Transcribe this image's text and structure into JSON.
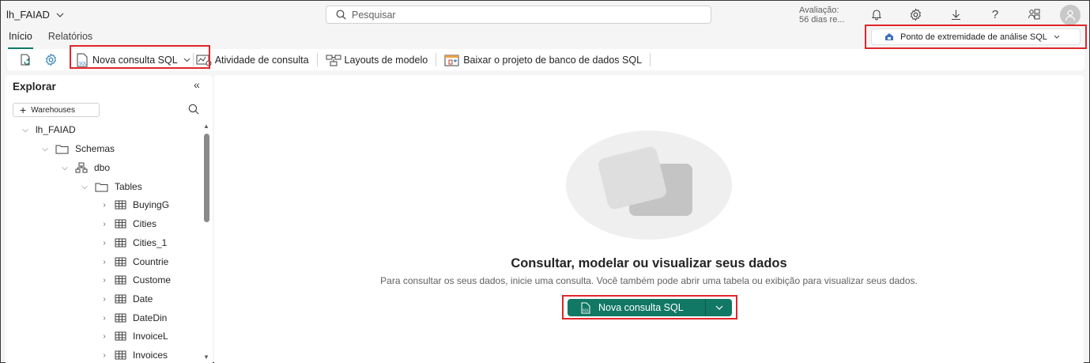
{
  "topbar": {
    "workspace": "lh_FAIAD",
    "search_placeholder": "Pesquisar",
    "trial_line1": "Avaliação:",
    "trial_line2": "56 dias re...",
    "icons": [
      "bell-icon",
      "gear-icon",
      "download-icon",
      "help-icon",
      "share-icon",
      "avatar-icon"
    ]
  },
  "tabs": [
    {
      "label": "Início",
      "active": true
    },
    {
      "label": "Relatórios",
      "active": false
    }
  ],
  "endpoint": {
    "label": "Ponto de extremidade de análise SQL"
  },
  "toolbar": {
    "nova_consulta": "Nova consulta SQL",
    "atividade": "Atividade de consulta",
    "layouts": "Layouts de modelo",
    "baixar": "Baixar o projeto de banco de dados SQL"
  },
  "explorer": {
    "title": "Explorar",
    "warehouses_button": "Warehouses",
    "root": "lh_FAIAD",
    "schemas": "Schemas",
    "schema_dbo": "dbo",
    "tables_folder": "Tables",
    "tables": [
      "BuyingG",
      "Cities",
      "Cities_1",
      "Countrie",
      "Custome",
      "Date",
      "DateDin",
      "InvoiceL",
      "Invoices"
    ]
  },
  "main": {
    "title": "Consultar, modelar ou visualizar seus dados",
    "subtitle": "Para consultar os seus dados, inicie uma consulta. Você também pode abrir uma tabela ou exibição para visualizar seus dados.",
    "cta_label": "Nova consulta SQL"
  },
  "colors": {
    "accent": "#117865",
    "highlight": "#e0262a"
  }
}
